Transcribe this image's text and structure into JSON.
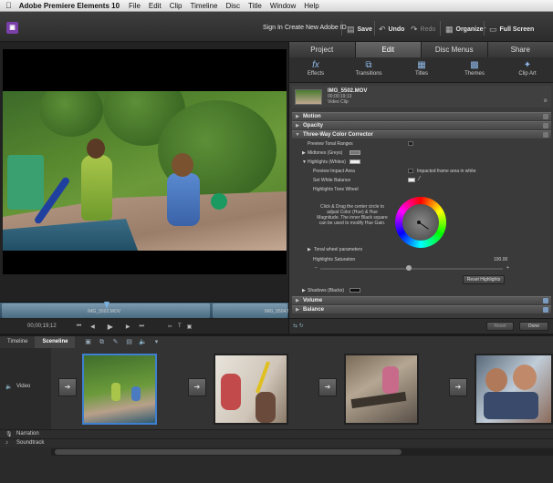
{
  "menubar": {
    "app_name": "Adobe Premiere Elements 10",
    "items": [
      "File",
      "Edit",
      "Clip",
      "Timeline",
      "Disc",
      "Title",
      "Window",
      "Help"
    ]
  },
  "toolbar": {
    "signin": "Sign In",
    "create_id": "Create New Adobe ID",
    "save": "Save",
    "undo": "Undo",
    "redo": "Redo",
    "organizer": "Organizer",
    "fullscreen": "Full Screen"
  },
  "monitor": {
    "clip1_label": "IMG_5502.MOV",
    "clip2_label": "IMG_5504.M",
    "timecode": "00;00;19;12"
  },
  "panel": {
    "tabs": [
      "Project",
      "Edit",
      "Disc Menus",
      "Share"
    ],
    "active_tab": "Edit",
    "subtabs": [
      {
        "label": "Effects",
        "icon": "fx-icon"
      },
      {
        "label": "Transitions",
        "icon": "transitions-icon"
      },
      {
        "label": "Titles",
        "icon": "titles-icon"
      },
      {
        "label": "Themes",
        "icon": "themes-icon"
      },
      {
        "label": "Clip Art",
        "icon": "clipart-icon"
      }
    ],
    "clip": {
      "name": "IMG_5502.MOV",
      "duration": "00;00;19;13",
      "type": "Video Clip"
    },
    "sections": {
      "motion": "Motion",
      "opacity": "Opacity",
      "three_way": "Three-Way Color Corrector",
      "shadows": "Shadows (Blacks)",
      "volume": "Volume",
      "balance": "Balance"
    },
    "tcc": {
      "preview_ranges": "Preview Tonal Ranges",
      "midtones": "Midtones (Greys)",
      "highlights": "Highlights (Whites)",
      "preview_impact": "Preview Impact Area",
      "impacted_frame": "Impacted frame area in white",
      "set_white_balance": "Set White Balance",
      "tone_wheel": "Highlights Tone Wheel",
      "wheel_help": "Click & Drag the center circle to adjust Color (Hue) & Hue Magnitude. The inner Black square can be used to modify Hue Gain.",
      "tonal_params": "Tonal wheel parameters",
      "saturation_label": "Highlights Saturation",
      "saturation_value": "100.00",
      "reset": "Reset Highlights"
    },
    "footer": {
      "reset": "Reset",
      "done": "Done"
    }
  },
  "sceneline": {
    "tabs": [
      "Timeline",
      "Sceneline"
    ],
    "active_tab": "Sceneline",
    "video_label": "Video",
    "narration_label": "Narration",
    "soundtrack_label": "Soundtrack"
  }
}
